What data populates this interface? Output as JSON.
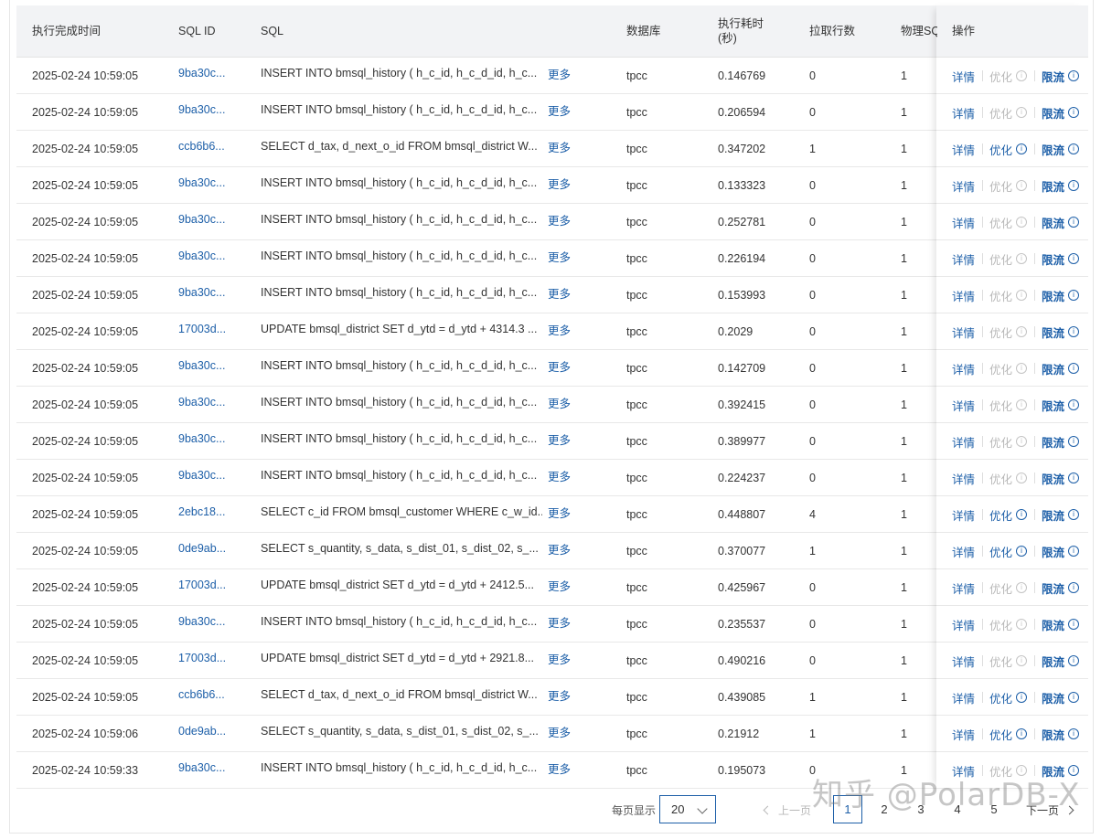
{
  "columns": {
    "time": "执行完成时间",
    "sql_id": "SQL ID",
    "sql": "SQL",
    "db": "数据库",
    "exec_time_1": "执行耗时",
    "exec_time_2": "(秒)",
    "rows": "拉取行数",
    "phys": "物理SQ",
    "ops": "操作"
  },
  "labels": {
    "more": "更多",
    "detail": "详情",
    "optimize": "优化",
    "limit": "限流",
    "info_glyph": "i"
  },
  "rows": [
    {
      "time": "2025-02-24 10:59:05",
      "sql_id": "9ba30c...",
      "sql": "INSERT INTO bmsql_history ( h_c_id, h_c_d_id, h_c...",
      "db": "tpcc",
      "exec": "0.146769",
      "rows": "0",
      "phys": "1",
      "optimize_enabled": false
    },
    {
      "time": "2025-02-24 10:59:05",
      "sql_id": "9ba30c...",
      "sql": "INSERT INTO bmsql_history ( h_c_id, h_c_d_id, h_c...",
      "db": "tpcc",
      "exec": "0.206594",
      "rows": "0",
      "phys": "1",
      "optimize_enabled": false
    },
    {
      "time": "2025-02-24 10:59:05",
      "sql_id": "ccb6b6...",
      "sql": "SELECT d_tax, d_next_o_id FROM bmsql_district W...",
      "db": "tpcc",
      "exec": "0.347202",
      "rows": "1",
      "phys": "1",
      "optimize_enabled": true
    },
    {
      "time": "2025-02-24 10:59:05",
      "sql_id": "9ba30c...",
      "sql": "INSERT INTO bmsql_history ( h_c_id, h_c_d_id, h_c...",
      "db": "tpcc",
      "exec": "0.133323",
      "rows": "0",
      "phys": "1",
      "optimize_enabled": false
    },
    {
      "time": "2025-02-24 10:59:05",
      "sql_id": "9ba30c...",
      "sql": "INSERT INTO bmsql_history ( h_c_id, h_c_d_id, h_c...",
      "db": "tpcc",
      "exec": "0.252781",
      "rows": "0",
      "phys": "1",
      "optimize_enabled": false
    },
    {
      "time": "2025-02-24 10:59:05",
      "sql_id": "9ba30c...",
      "sql": "INSERT INTO bmsql_history ( h_c_id, h_c_d_id, h_c...",
      "db": "tpcc",
      "exec": "0.226194",
      "rows": "0",
      "phys": "1",
      "optimize_enabled": false
    },
    {
      "time": "2025-02-24 10:59:05",
      "sql_id": "9ba30c...",
      "sql": "INSERT INTO bmsql_history ( h_c_id, h_c_d_id, h_c...",
      "db": "tpcc",
      "exec": "0.153993",
      "rows": "0",
      "phys": "1",
      "optimize_enabled": false
    },
    {
      "time": "2025-02-24 10:59:05",
      "sql_id": "17003d...",
      "sql": "UPDATE bmsql_district SET d_ytd = d_ytd + 4314.3 ...",
      "db": "tpcc",
      "exec": "0.2029",
      "rows": "0",
      "phys": "1",
      "optimize_enabled": false
    },
    {
      "time": "2025-02-24 10:59:05",
      "sql_id": "9ba30c...",
      "sql": "INSERT INTO bmsql_history ( h_c_id, h_c_d_id, h_c...",
      "db": "tpcc",
      "exec": "0.142709",
      "rows": "0",
      "phys": "1",
      "optimize_enabled": false
    },
    {
      "time": "2025-02-24 10:59:05",
      "sql_id": "9ba30c...",
      "sql": "INSERT INTO bmsql_history ( h_c_id, h_c_d_id, h_c...",
      "db": "tpcc",
      "exec": "0.392415",
      "rows": "0",
      "phys": "1",
      "optimize_enabled": false
    },
    {
      "time": "2025-02-24 10:59:05",
      "sql_id": "9ba30c...",
      "sql": "INSERT INTO bmsql_history ( h_c_id, h_c_d_id, h_c...",
      "db": "tpcc",
      "exec": "0.389977",
      "rows": "0",
      "phys": "1",
      "optimize_enabled": false
    },
    {
      "time": "2025-02-24 10:59:05",
      "sql_id": "9ba30c...",
      "sql": "INSERT INTO bmsql_history ( h_c_id, h_c_d_id, h_c...",
      "db": "tpcc",
      "exec": "0.224237",
      "rows": "0",
      "phys": "1",
      "optimize_enabled": false
    },
    {
      "time": "2025-02-24 10:59:05",
      "sql_id": "2ebc18...",
      "sql": "SELECT c_id FROM bmsql_customer WHERE c_w_id...",
      "db": "tpcc",
      "exec": "0.448807",
      "rows": "4",
      "phys": "1",
      "optimize_enabled": true
    },
    {
      "time": "2025-02-24 10:59:05",
      "sql_id": "0de9ab...",
      "sql": "SELECT s_quantity, s_data, s_dist_01, s_dist_02, s_...",
      "db": "tpcc",
      "exec": "0.370077",
      "rows": "1",
      "phys": "1",
      "optimize_enabled": true
    },
    {
      "time": "2025-02-24 10:59:05",
      "sql_id": "17003d...",
      "sql": "UPDATE bmsql_district SET d_ytd = d_ytd + 2412.5...",
      "db": "tpcc",
      "exec": "0.425967",
      "rows": "0",
      "phys": "1",
      "optimize_enabled": false
    },
    {
      "time": "2025-02-24 10:59:05",
      "sql_id": "9ba30c...",
      "sql": "INSERT INTO bmsql_history ( h_c_id, h_c_d_id, h_c...",
      "db": "tpcc",
      "exec": "0.235537",
      "rows": "0",
      "phys": "1",
      "optimize_enabled": false
    },
    {
      "time": "2025-02-24 10:59:05",
      "sql_id": "17003d...",
      "sql": "UPDATE bmsql_district SET d_ytd = d_ytd + 2921.8...",
      "db": "tpcc",
      "exec": "0.490216",
      "rows": "0",
      "phys": "1",
      "optimize_enabled": false
    },
    {
      "time": "2025-02-24 10:59:05",
      "sql_id": "ccb6b6...",
      "sql": "SELECT d_tax, d_next_o_id FROM bmsql_district W...",
      "db": "tpcc",
      "exec": "0.439085",
      "rows": "1",
      "phys": "1",
      "optimize_enabled": true
    },
    {
      "time": "2025-02-24 10:59:06",
      "sql_id": "0de9ab...",
      "sql": "SELECT s_quantity, s_data, s_dist_01, s_dist_02, s_...",
      "db": "tpcc",
      "exec": "0.21912",
      "rows": "1",
      "phys": "1",
      "optimize_enabled": true
    },
    {
      "time": "2025-02-24 10:59:33",
      "sql_id": "9ba30c...",
      "sql": "INSERT INTO bmsql_history ( h_c_id, h_c_d_id, h_c...",
      "db": "tpcc",
      "exec": "0.195073",
      "rows": "0",
      "phys": "1",
      "optimize_enabled": false
    }
  ],
  "pagination": {
    "page_size_label": "每页显示",
    "page_size": "20",
    "prev": "上一页",
    "next": "下一页",
    "pages": [
      "1",
      "2",
      "3",
      "4",
      "5"
    ],
    "current": "1"
  },
  "watermark": "知乎 @PolarDB-X",
  "colors": {
    "link": "#1d5fa8",
    "disabled": "#b8b8b8",
    "header_bg": "#f2f3f5"
  }
}
